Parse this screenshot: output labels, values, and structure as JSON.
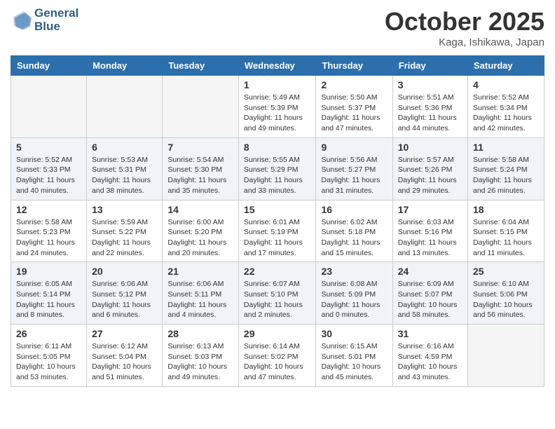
{
  "logo": {
    "line1": "General",
    "line2": "Blue"
  },
  "title": "October 2025",
  "location": "Kaga, Ishikawa, Japan",
  "days_of_week": [
    "Sunday",
    "Monday",
    "Tuesday",
    "Wednesday",
    "Thursday",
    "Friday",
    "Saturday"
  ],
  "weeks": [
    [
      {
        "day": "",
        "info": ""
      },
      {
        "day": "",
        "info": ""
      },
      {
        "day": "",
        "info": ""
      },
      {
        "day": "1",
        "info": "Sunrise: 5:49 AM\nSunset: 5:39 PM\nDaylight: 11 hours\nand 49 minutes."
      },
      {
        "day": "2",
        "info": "Sunrise: 5:50 AM\nSunset: 5:37 PM\nDaylight: 11 hours\nand 47 minutes."
      },
      {
        "day": "3",
        "info": "Sunrise: 5:51 AM\nSunset: 5:36 PM\nDaylight: 11 hours\nand 44 minutes."
      },
      {
        "day": "4",
        "info": "Sunrise: 5:52 AM\nSunset: 5:34 PM\nDaylight: 11 hours\nand 42 minutes."
      }
    ],
    [
      {
        "day": "5",
        "info": "Sunrise: 5:52 AM\nSunset: 5:33 PM\nDaylight: 11 hours\nand 40 minutes."
      },
      {
        "day": "6",
        "info": "Sunrise: 5:53 AM\nSunset: 5:31 PM\nDaylight: 11 hours\nand 38 minutes."
      },
      {
        "day": "7",
        "info": "Sunrise: 5:54 AM\nSunset: 5:30 PM\nDaylight: 11 hours\nand 35 minutes."
      },
      {
        "day": "8",
        "info": "Sunrise: 5:55 AM\nSunset: 5:29 PM\nDaylight: 11 hours\nand 33 minutes."
      },
      {
        "day": "9",
        "info": "Sunrise: 5:56 AM\nSunset: 5:27 PM\nDaylight: 11 hours\nand 31 minutes."
      },
      {
        "day": "10",
        "info": "Sunrise: 5:57 AM\nSunset: 5:26 PM\nDaylight: 11 hours\nand 29 minutes."
      },
      {
        "day": "11",
        "info": "Sunrise: 5:58 AM\nSunset: 5:24 PM\nDaylight: 11 hours\nand 26 minutes."
      }
    ],
    [
      {
        "day": "12",
        "info": "Sunrise: 5:58 AM\nSunset: 5:23 PM\nDaylight: 11 hours\nand 24 minutes."
      },
      {
        "day": "13",
        "info": "Sunrise: 5:59 AM\nSunset: 5:22 PM\nDaylight: 11 hours\nand 22 minutes."
      },
      {
        "day": "14",
        "info": "Sunrise: 6:00 AM\nSunset: 5:20 PM\nDaylight: 11 hours\nand 20 minutes."
      },
      {
        "day": "15",
        "info": "Sunrise: 6:01 AM\nSunset: 5:19 PM\nDaylight: 11 hours\nand 17 minutes."
      },
      {
        "day": "16",
        "info": "Sunrise: 6:02 AM\nSunset: 5:18 PM\nDaylight: 11 hours\nand 15 minutes."
      },
      {
        "day": "17",
        "info": "Sunrise: 6:03 AM\nSunset: 5:16 PM\nDaylight: 11 hours\nand 13 minutes."
      },
      {
        "day": "18",
        "info": "Sunrise: 6:04 AM\nSunset: 5:15 PM\nDaylight: 11 hours\nand 11 minutes."
      }
    ],
    [
      {
        "day": "19",
        "info": "Sunrise: 6:05 AM\nSunset: 5:14 PM\nDaylight: 11 hours\nand 8 minutes."
      },
      {
        "day": "20",
        "info": "Sunrise: 6:06 AM\nSunset: 5:12 PM\nDaylight: 11 hours\nand 6 minutes."
      },
      {
        "day": "21",
        "info": "Sunrise: 6:06 AM\nSunset: 5:11 PM\nDaylight: 11 hours\nand 4 minutes."
      },
      {
        "day": "22",
        "info": "Sunrise: 6:07 AM\nSunset: 5:10 PM\nDaylight: 11 hours\nand 2 minutes."
      },
      {
        "day": "23",
        "info": "Sunrise: 6:08 AM\nSunset: 5:09 PM\nDaylight: 11 hours\nand 0 minutes."
      },
      {
        "day": "24",
        "info": "Sunrise: 6:09 AM\nSunset: 5:07 PM\nDaylight: 10 hours\nand 58 minutes."
      },
      {
        "day": "25",
        "info": "Sunrise: 6:10 AM\nSunset: 5:06 PM\nDaylight: 10 hours\nand 56 minutes."
      }
    ],
    [
      {
        "day": "26",
        "info": "Sunrise: 6:11 AM\nSunset: 5:05 PM\nDaylight: 10 hours\nand 53 minutes."
      },
      {
        "day": "27",
        "info": "Sunrise: 6:12 AM\nSunset: 5:04 PM\nDaylight: 10 hours\nand 51 minutes."
      },
      {
        "day": "28",
        "info": "Sunrise: 6:13 AM\nSunset: 5:03 PM\nDaylight: 10 hours\nand 49 minutes."
      },
      {
        "day": "29",
        "info": "Sunrise: 6:14 AM\nSunset: 5:02 PM\nDaylight: 10 hours\nand 47 minutes."
      },
      {
        "day": "30",
        "info": "Sunrise: 6:15 AM\nSunset: 5:01 PM\nDaylight: 10 hours\nand 45 minutes."
      },
      {
        "day": "31",
        "info": "Sunrise: 6:16 AM\nSunset: 4:59 PM\nDaylight: 10 hours\nand 43 minutes."
      },
      {
        "day": "",
        "info": ""
      }
    ]
  ]
}
